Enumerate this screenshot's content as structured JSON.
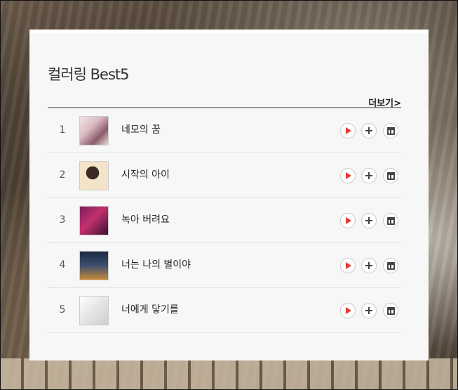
{
  "section": {
    "title": "컬러링 Best5",
    "more_label": "더보기>"
  },
  "songs": [
    {
      "rank": "1",
      "title": "네모의 꿈"
    },
    {
      "rank": "2",
      "title": "시작의 아이"
    },
    {
      "rank": "3",
      "title": "녹아 버려요"
    },
    {
      "rank": "4",
      "title": "너는 나의 별이야"
    },
    {
      "rank": "5",
      "title": "너에게 닿기를"
    }
  ],
  "actions": {
    "play_icon": "play-icon",
    "add_icon": "plus-icon",
    "gift_icon": "gift-icon",
    "play_color": "#e53935"
  }
}
